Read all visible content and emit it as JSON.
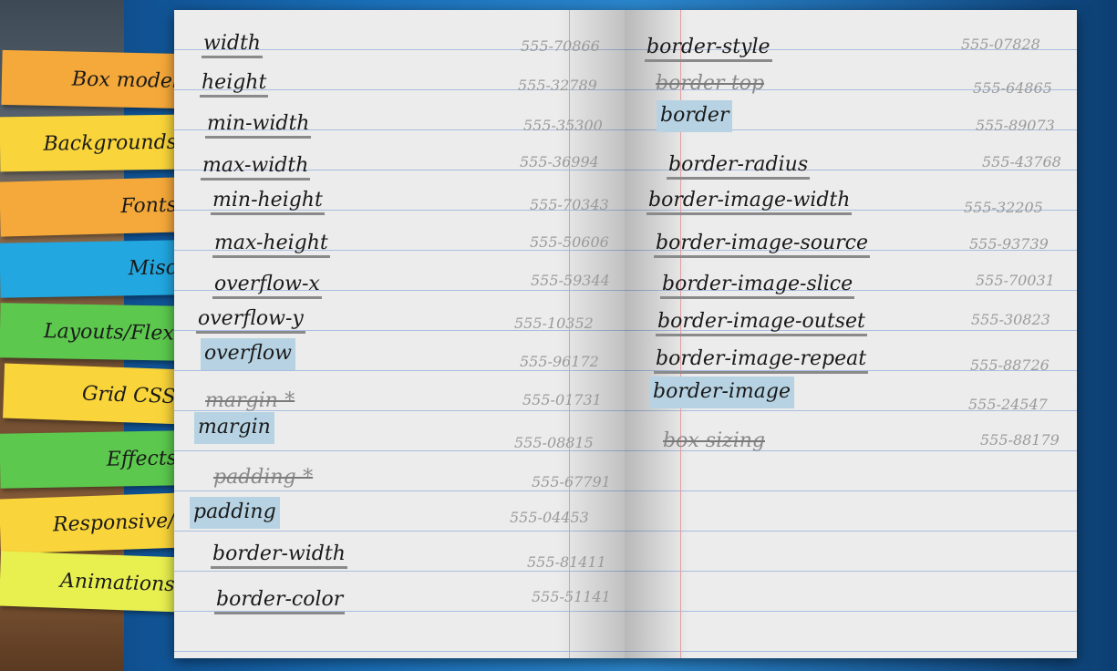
{
  "tabs": [
    {
      "label": "Box model",
      "color": "#f5a93a"
    },
    {
      "label": "Backgrounds",
      "color": "#f9d43a"
    },
    {
      "label": "Fonts",
      "color": "#f5a93a"
    },
    {
      "label": "Misc",
      "color": "#22a7e0"
    },
    {
      "label": "Layouts/Flexbox",
      "color": "#5cc94e"
    },
    {
      "label": "Grid CSS",
      "color": "#f9d43a"
    },
    {
      "label": "Effects",
      "color": "#5cc94e"
    },
    {
      "label": "Responsive/Media",
      "color": "#f9d43a"
    },
    {
      "label": "Animations",
      "color": "#e8f050"
    }
  ],
  "left_page": [
    {
      "term": "width",
      "phone": "555-70866",
      "style": "normal"
    },
    {
      "term": "height",
      "phone": "555-32789",
      "style": "normal"
    },
    {
      "term": "min-width",
      "phone": "555-35300",
      "style": "normal"
    },
    {
      "term": "max-width",
      "phone": "555-36994",
      "style": "normal"
    },
    {
      "term": "min-height",
      "phone": "555-70343",
      "style": "normal"
    },
    {
      "term": "max-height",
      "phone": "555-50606",
      "style": "normal"
    },
    {
      "term": "overflow-x",
      "phone": "555-59344",
      "style": "normal"
    },
    {
      "term": "overflow-y",
      "phone": "555-10352",
      "style": "normal"
    },
    {
      "term": "overflow",
      "phone": "555-96172",
      "style": "highlight"
    },
    {
      "term": "margin-*",
      "phone": "555-01731",
      "style": "struck"
    },
    {
      "term": "margin",
      "phone": "555-08815",
      "style": "highlight"
    },
    {
      "term": "padding-*",
      "phone": "555-67791",
      "style": "struck"
    },
    {
      "term": "padding",
      "phone": "555-04453",
      "style": "highlight"
    },
    {
      "term": "border-width",
      "phone": "555-81411",
      "style": "normal"
    },
    {
      "term": "border-color",
      "phone": "555-51141",
      "style": "normal"
    }
  ],
  "right_page": [
    {
      "term": "border-style",
      "phone": "555-07828",
      "style": "normal"
    },
    {
      "term": "border-top",
      "phone": "555-64865",
      "style": "struck"
    },
    {
      "term": "border",
      "phone": "555-89073",
      "style": "highlight"
    },
    {
      "term": "border-radius",
      "phone": "555-43768",
      "style": "normal"
    },
    {
      "term": "border-image-width",
      "phone": "555-32205",
      "style": "normal"
    },
    {
      "term": "border-image-source",
      "phone": "555-93739",
      "style": "normal"
    },
    {
      "term": "border-image-slice",
      "phone": "555-70031",
      "style": "normal"
    },
    {
      "term": "border-image-outset",
      "phone": "555-30823",
      "style": "normal"
    },
    {
      "term": "border-image-repeat",
      "phone": "555-88726",
      "style": "normal"
    },
    {
      "term": "border-image",
      "phone": "555-24547",
      "style": "highlight"
    },
    {
      "term": "box-sizing",
      "phone": "555-88179",
      "style": "struck"
    }
  ]
}
